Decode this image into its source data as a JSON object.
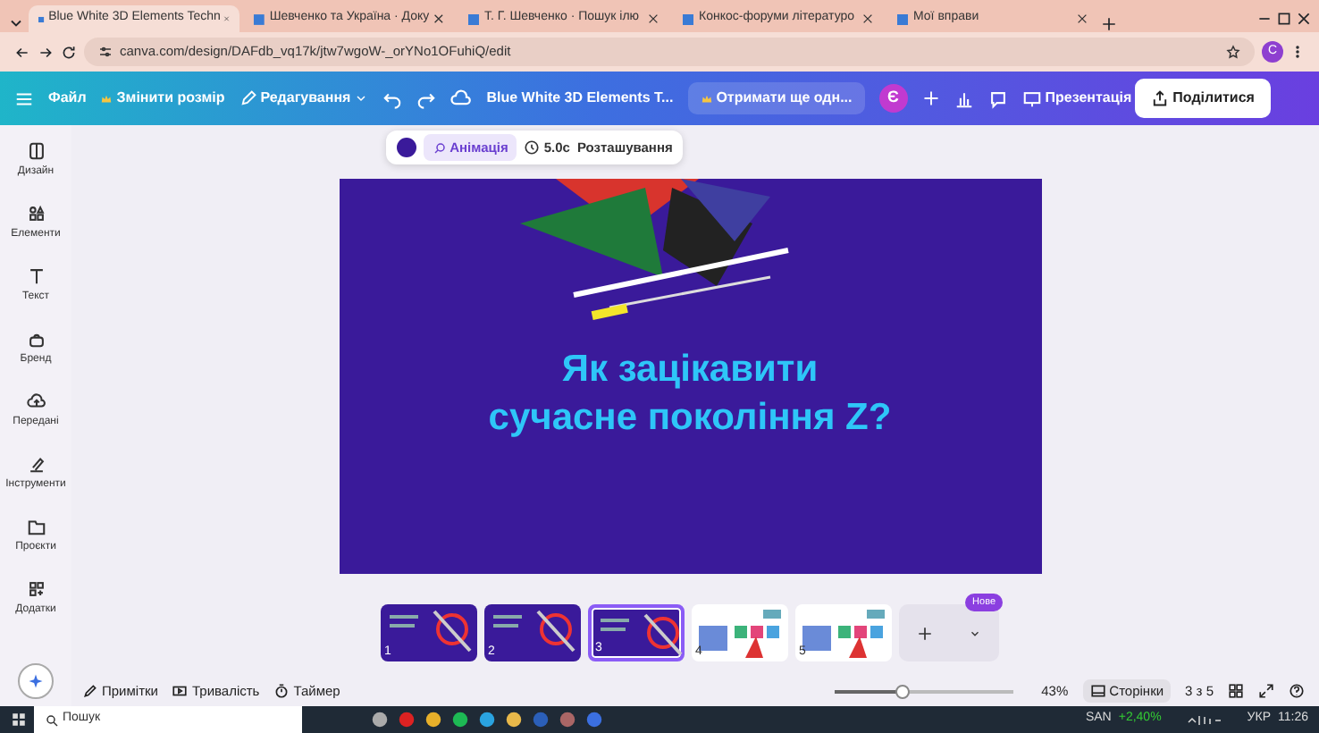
{
  "browser": {
    "tabs": [
      {
        "label": "Blue White 3D Elements Techn",
        "selected": true
      },
      {
        "label": "Шевченко та Україна · Доку",
        "selected": false
      },
      {
        "label": "Т. Г. Шевченко · Пошук ілю",
        "selected": false
      },
      {
        "label": "Конкос-форуми літературо",
        "selected": false
      },
      {
        "label": "Мої вправи",
        "selected": false
      }
    ],
    "address": "canva.com/design/DAFdb_vq17k/jtw7wgoW-_orYNo1OFuhiQ/edit",
    "profile": "C"
  },
  "toolbar": {
    "file": "Файл",
    "resize": "Змінити розмір",
    "edit": "Редагування",
    "title": "Blue White 3D Elements T...",
    "upgrade": "Отримати ще одн...",
    "avatar": "Є",
    "present": "Презентація",
    "share": "Поділитися"
  },
  "sidebar": {
    "items": [
      {
        "label": "Дизайн",
        "kind": "design"
      },
      {
        "label": "Елементи",
        "kind": "elements"
      },
      {
        "label": "Текст",
        "kind": "text"
      },
      {
        "label": "Бренд",
        "kind": "brand"
      },
      {
        "label": "Передані",
        "kind": "uploads"
      },
      {
        "label": "Інструменти",
        "kind": "tools"
      },
      {
        "label": "Проєкти",
        "kind": "projects"
      },
      {
        "label": "Додатки",
        "kind": "apps"
      }
    ]
  },
  "context_toolbar": {
    "color": "#3a1a9a",
    "animation": "Анімація",
    "duration": "5.0с",
    "position": "Розташування"
  },
  "slide": {
    "title_lines": [
      "Як зацікавити",
      "сучасне покоління Z?"
    ]
  },
  "pages": {
    "items": [
      {
        "number": "1",
        "kind": "dark",
        "selected": false
      },
      {
        "number": "2",
        "kind": "dark",
        "selected": false
      },
      {
        "number": "3",
        "kind": "dark",
        "selected": true
      },
      {
        "number": "4",
        "kind": "light",
        "selected": false
      },
      {
        "number": "5",
        "kind": "light",
        "selected": false
      }
    ],
    "new_badge": "Нове"
  },
  "footer": {
    "notes": "Примітки",
    "duration": "Тривалість",
    "timer": "Таймер",
    "zoom": {
      "level": 0.38,
      "reading": "43%"
    },
    "pages_button": "Сторінки",
    "page_count": "3 з 5"
  },
  "taskbar": {
    "search": "Пошук",
    "ticker": "SAN",
    "change": "+2,40%",
    "lang": "УКР",
    "time": "11:26"
  }
}
